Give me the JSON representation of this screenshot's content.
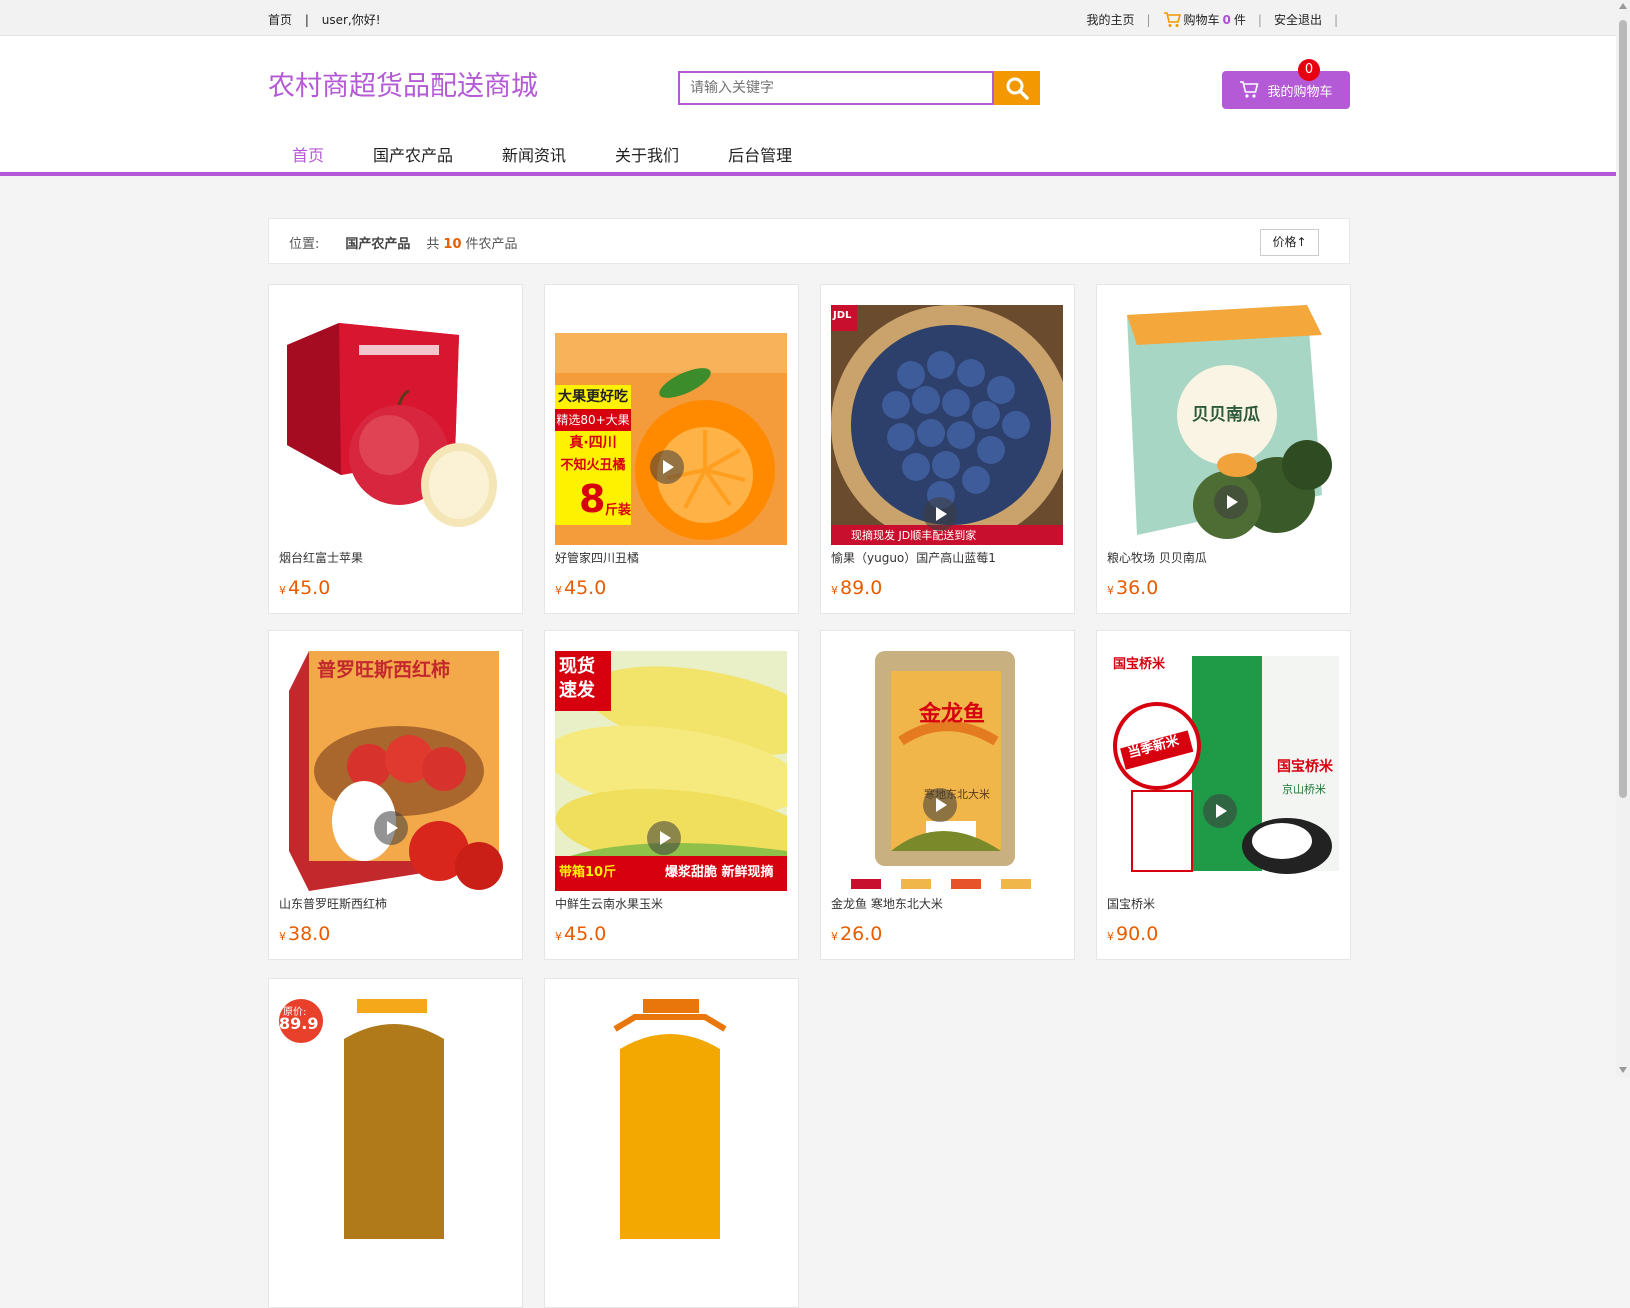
{
  "topbar": {
    "home": "首页",
    "separator": "|",
    "greeting": "user,你好!",
    "my_home": "我的主页",
    "cart_label": "购物车",
    "cart_count": "0",
    "cart_unit": "件",
    "logout": "安全退出"
  },
  "header": {
    "logo": "农村商超货品配送商城",
    "search_placeholder": "请输入关键字",
    "cart_button": "我的购物车",
    "cart_badge": "0"
  },
  "nav": [
    "首页",
    "国产农产品",
    "新闻资讯",
    "关于我们",
    "后台管理"
  ],
  "location": {
    "label": "位置:",
    "category": "国产农产品",
    "total_prefix": "共",
    "total_count": "10",
    "total_suffix": "件农产品",
    "sort_button": "价格↑"
  },
  "currency": "¥",
  "products": [
    {
      "name": "烟台红富士苹果",
      "price": "45.0",
      "image": "apple-box"
    },
    {
      "name": "好管家四川丑橘",
      "price": "45.0",
      "image": "orange-box"
    },
    {
      "name": "愉果（yuguo）国产高山蓝莓1",
      "price": "89.0",
      "image": "blueberries"
    },
    {
      "name": "粮心牧场 贝贝南瓜",
      "price": "36.0",
      "image": "pumpkin-box"
    },
    {
      "name": "山东普罗旺斯西红柿",
      "price": "38.0",
      "image": "tomato-box"
    },
    {
      "name": "中鲜生云南水果玉米",
      "price": "45.0",
      "image": "corn"
    },
    {
      "name": "金龙鱼 寒地东北大米",
      "price": "26.0",
      "image": "rice-bag"
    },
    {
      "name": "国宝桥米",
      "price": "90.0",
      "image": "rice-bag-green"
    },
    {
      "name": "",
      "price": "",
      "image": "oil-bottle"
    },
    {
      "name": "",
      "price": "",
      "image": "oil-bottle-2"
    }
  ],
  "image_text": {
    "orange_1": "大果更好吃",
    "orange_2": "精选80+大果",
    "orange_3": "真·四川",
    "orange_4": "不知火丑橘",
    "orange_5": "8",
    "orange_6": "斤装",
    "blueberry_1": "现摘现发 JD顺丰配送到家",
    "pumpkin": "贝贝南瓜",
    "tomato": "普罗旺斯西红柿",
    "corn_1": "现货速发",
    "corn_2": "带箱10斤",
    "corn_3": "爆浆甜脆 新鲜现摘",
    "rice_1": "金龙鱼",
    "rice_2": "寒地东北大米",
    "rice2_1": "国宝桥米",
    "rice2_2": "当季新米",
    "rice2_3": "京山桥米",
    "oil_1": "原价:",
    "oil_2": "89.9"
  }
}
